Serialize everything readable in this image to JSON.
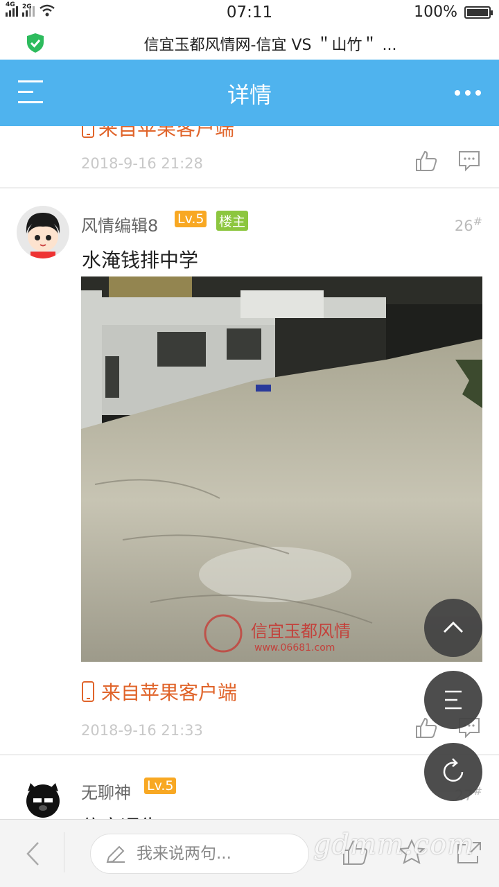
{
  "status": {
    "net1": "4G",
    "net2": "2G",
    "time": "07:11",
    "battery": "100%"
  },
  "browser": {
    "page_title": "信宜玉都风情网-信宜 VS ＂山竹＂ ..."
  },
  "nav": {
    "title": "详情"
  },
  "post_prev": {
    "source": "来自苹果客户端",
    "date": "2018-9-16 21:28"
  },
  "post": {
    "author": "风情编辑8",
    "level": "Lv.5",
    "owner_tag": "楼主",
    "floor": "26",
    "floor_mark": "#",
    "text": "水淹钱排中学",
    "source": "来自苹果客户端",
    "date": "2018-9-16 21:33",
    "image_watermark": "信宜玉都风情",
    "image_url_text": "www.06681.com"
  },
  "post_next": {
    "author": "无聊神",
    "level": "Lv.5",
    "floor": "27",
    "floor_mark": "#",
    "text": "信宜通告"
  },
  "bottom": {
    "placeholder": "我来说两句..."
  },
  "watermark": "gdmm.com",
  "colors": {
    "nav": "#4fb3ee",
    "accent": "#e0642a",
    "level": "#f8a823",
    "owner": "#8cc63f"
  }
}
